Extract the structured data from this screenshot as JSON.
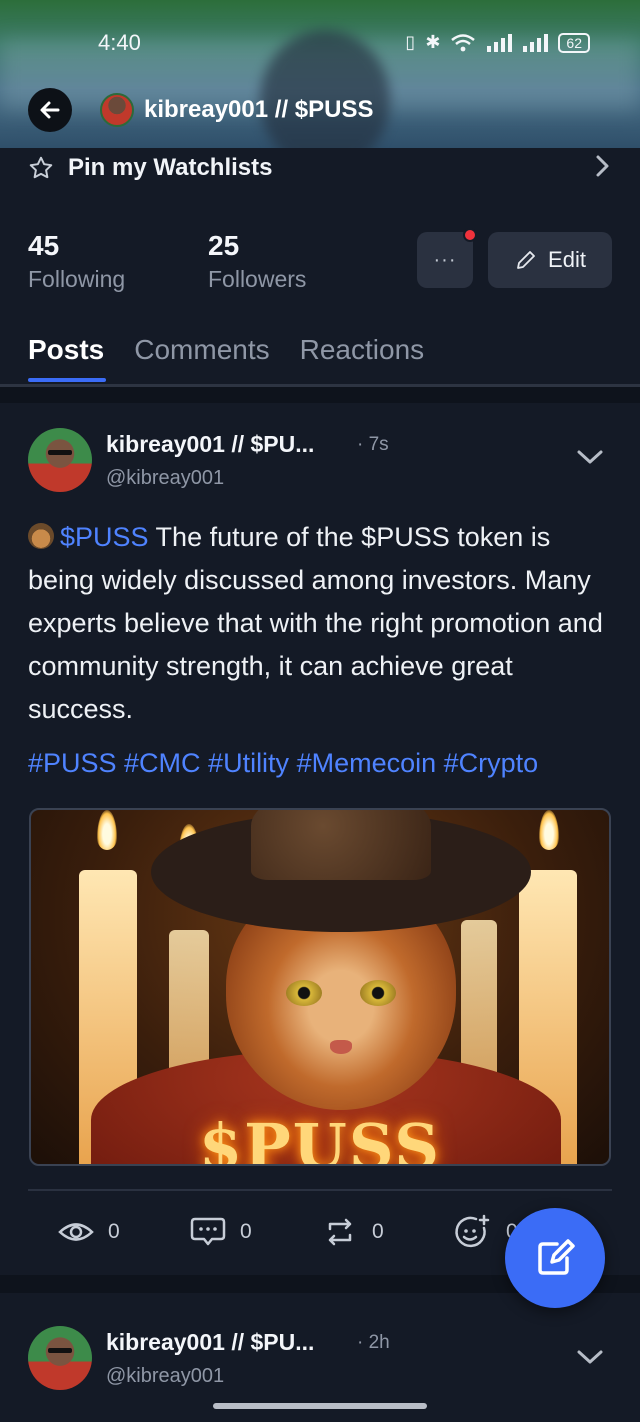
{
  "status_bar": {
    "time": "4:40",
    "battery": "62"
  },
  "header": {
    "title": "kibreay001 // $PUSS"
  },
  "watchlist": {
    "label": "Pin my Watchlists"
  },
  "stats": {
    "following": {
      "count": "45",
      "label": "Following"
    },
    "followers": {
      "count": "25",
      "label": "Followers"
    }
  },
  "buttons": {
    "more": "···",
    "edit": "Edit"
  },
  "tabs": [
    {
      "label": "Posts",
      "active": true
    },
    {
      "label": "Comments",
      "active": false
    },
    {
      "label": "Reactions",
      "active": false
    }
  ],
  "posts": [
    {
      "name": "kibreay001 // $PU...",
      "time": "· 7s",
      "handle": "@kibreay001",
      "cashtag": "$PUSS",
      "text": " The future of the $PUSS token is being widely discussed among investors. Many experts believe that with the right promotion and community strength, it can achieve great success.",
      "hashtags": "#PUSS #CMC #Utility #Memecoin #Crypto",
      "image_text": "$PUSS",
      "actions": {
        "views": "0",
        "comments": "0",
        "reposts": "0",
        "reactions": "0"
      }
    },
    {
      "name": "kibreay001 // $PU...",
      "time": "· 2h",
      "handle": "@kibreay001"
    }
  ],
  "colors": {
    "accent": "#3b6cf6",
    "link": "#4f83ff",
    "background": "#141a26",
    "notification_dot": "#f0323c"
  },
  "icons": [
    "back-arrow-icon",
    "star-icon",
    "chevron-right-icon",
    "more-icon",
    "pencil-icon",
    "chevron-down-icon",
    "eye-icon",
    "comment-icon",
    "repost-icon",
    "emoji-add-icon",
    "compose-icon"
  ]
}
